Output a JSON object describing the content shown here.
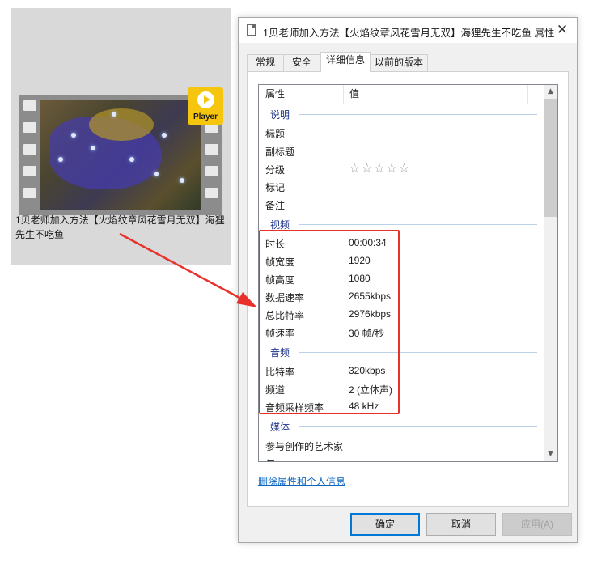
{
  "file_tile": {
    "filename": "1贝老师加入方法【火焰纹章风花雪月无双】海狸先生不吃鱼",
    "badge_label": "Player"
  },
  "dialog": {
    "title": "1贝老师加入方法【火焰纹章风花雪月无双】海狸先生不吃鱼 属性",
    "close_glyph": "✕",
    "tabs": [
      {
        "label": "常规",
        "active": false
      },
      {
        "label": "安全",
        "active": false
      },
      {
        "label": "详细信息",
        "active": true
      },
      {
        "label": "以前的版本",
        "active": false
      }
    ],
    "list": {
      "col_property": "属性",
      "col_value": "值",
      "groups": {
        "description": "说明",
        "video": "视频",
        "audio": "音频",
        "media": "媒体"
      },
      "description_rows": [
        {
          "name": "标题",
          "value": ""
        },
        {
          "name": "副标题",
          "value": ""
        },
        {
          "name": "分级",
          "value": "☆☆☆☆☆"
        },
        {
          "name": "标记",
          "value": ""
        },
        {
          "name": "备注",
          "value": ""
        }
      ],
      "video_rows": [
        {
          "name": "时长",
          "value": "00:00:34"
        },
        {
          "name": "帧宽度",
          "value": "1920"
        },
        {
          "name": "帧高度",
          "value": "1080"
        },
        {
          "name": "数据速率",
          "value": "2655kbps"
        },
        {
          "name": "总比特率",
          "value": "2976kbps"
        },
        {
          "name": "帧速率",
          "value": "30 帧/秒"
        }
      ],
      "audio_rows": [
        {
          "name": "比特率",
          "value": "320kbps"
        },
        {
          "name": "频道",
          "value": "2 (立体声)"
        },
        {
          "name": "音频采样频率",
          "value": "48 kHz"
        }
      ],
      "media_rows": [
        {
          "name": "参与创作的艺术家",
          "value": ""
        },
        {
          "name": "年",
          "value": ""
        }
      ],
      "scroll_up_glyph": "▲",
      "scroll_down_glyph": "▼"
    },
    "remove_link": "删除属性和个人信息",
    "buttons": {
      "ok": "确定",
      "cancel": "取消",
      "apply": "应用(A)"
    }
  },
  "colors": {
    "highlight": "#e8312b",
    "arrow": "#e8312b",
    "group_label": "#1e3287",
    "link": "#0a66c2",
    "badge": "#f6c60f"
  },
  "icons": {
    "file_icon": "document-icon",
    "play_icon": "play-icon",
    "close_icon": "close-icon"
  }
}
